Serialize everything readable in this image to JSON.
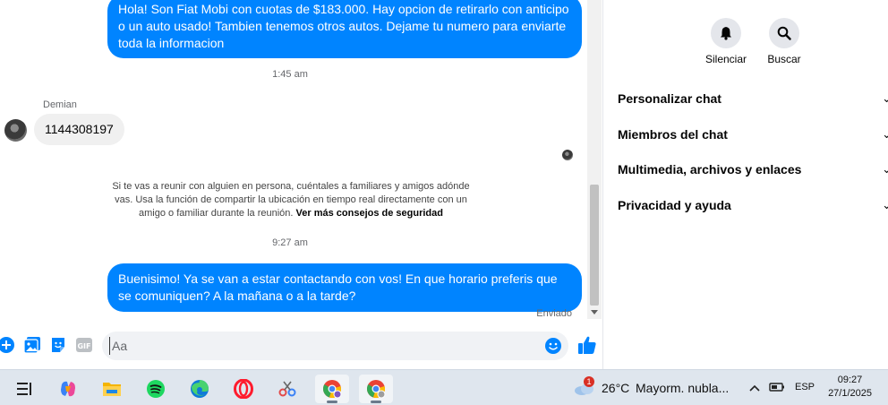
{
  "chat": {
    "messages": {
      "out1": "Hola! Son Fiat Mobi con cuotas de $183.000. Hay opcion de retirarlo con anticipo o un auto usado! Tambien tenemos otros autos. Dejame tu numero para enviarte toda la informacion",
      "ts1": "1:45 am",
      "sender_name": "Demian",
      "in1": "1144308197",
      "safety_text": "Si te vas a reunir con alguien en persona, cuéntales a familiares y amigos adónde vas. Usa la función de compartir la ubicación en tiempo real directamente con un amigo o familiar durante la reunión.",
      "safety_link": "Ver más consejos de seguridad",
      "ts2": "9:27 am",
      "out2": "Buenisimo! Ya se van a estar contactando con vos! En que horario preferis que se comuniquen? A la mañana o a la tarde?",
      "status": "Enviado"
    },
    "composer": {
      "placeholder": "Aa"
    }
  },
  "details": {
    "actions": {
      "mute": "Silenciar",
      "search": "Buscar"
    },
    "menu": [
      "Personalizar chat",
      "Miembros del chat",
      "Multimedia, archivos y enlaces",
      "Privacidad y ayuda"
    ]
  },
  "taskbar": {
    "weather_temp": "26°C",
    "weather_desc": "Mayorm. nubla...",
    "notification_count": "1",
    "lang": "ESP",
    "time": "09:27",
    "date": "27/1/2025"
  },
  "colors": {
    "messenger_blue": "#0084ff",
    "bubble_gray": "#f0f0f0"
  }
}
